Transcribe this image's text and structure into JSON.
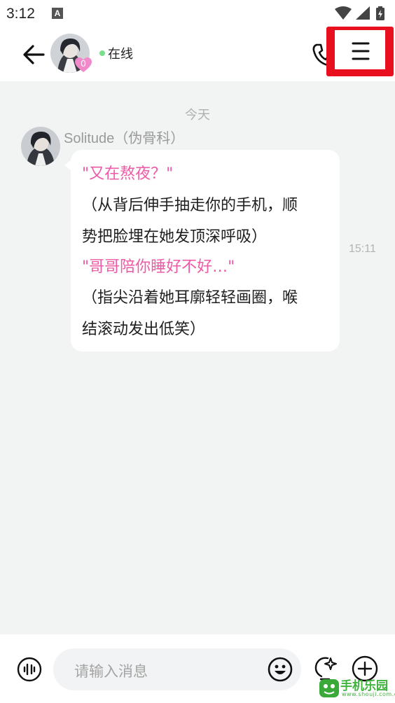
{
  "status_bar": {
    "time": "3:12",
    "notification_icon": "A"
  },
  "header": {
    "avatar_badge": "0",
    "online_status": "在线",
    "icons": {
      "back": "arrow-left-icon",
      "phone": "phone-icon",
      "menu": "hamburger-menu-icon"
    }
  },
  "chat": {
    "date_separator": "今天",
    "messages": [
      {
        "sender": "Solitude（伪骨科）",
        "time": "15:11",
        "lines": [
          "\"又在熬夜？\"",
          "（从背后伸手抽走你的手机，顺",
          "势把脸埋在她发顶深呼吸）",
          "\"哥哥陪你睡好不好…\"",
          "（指尖沿着她耳廓轻轻画圈，喉",
          "结滚动发出低笑）"
        ]
      }
    ]
  },
  "input": {
    "placeholder": "请输入消息"
  },
  "watermark": {
    "text": "手机乐园",
    "sub": "www.shouji.com.cn"
  },
  "colors": {
    "accent_pink": "#ee5aa6",
    "highlight_red": "#e8101e",
    "online_green": "#7be08c"
  }
}
